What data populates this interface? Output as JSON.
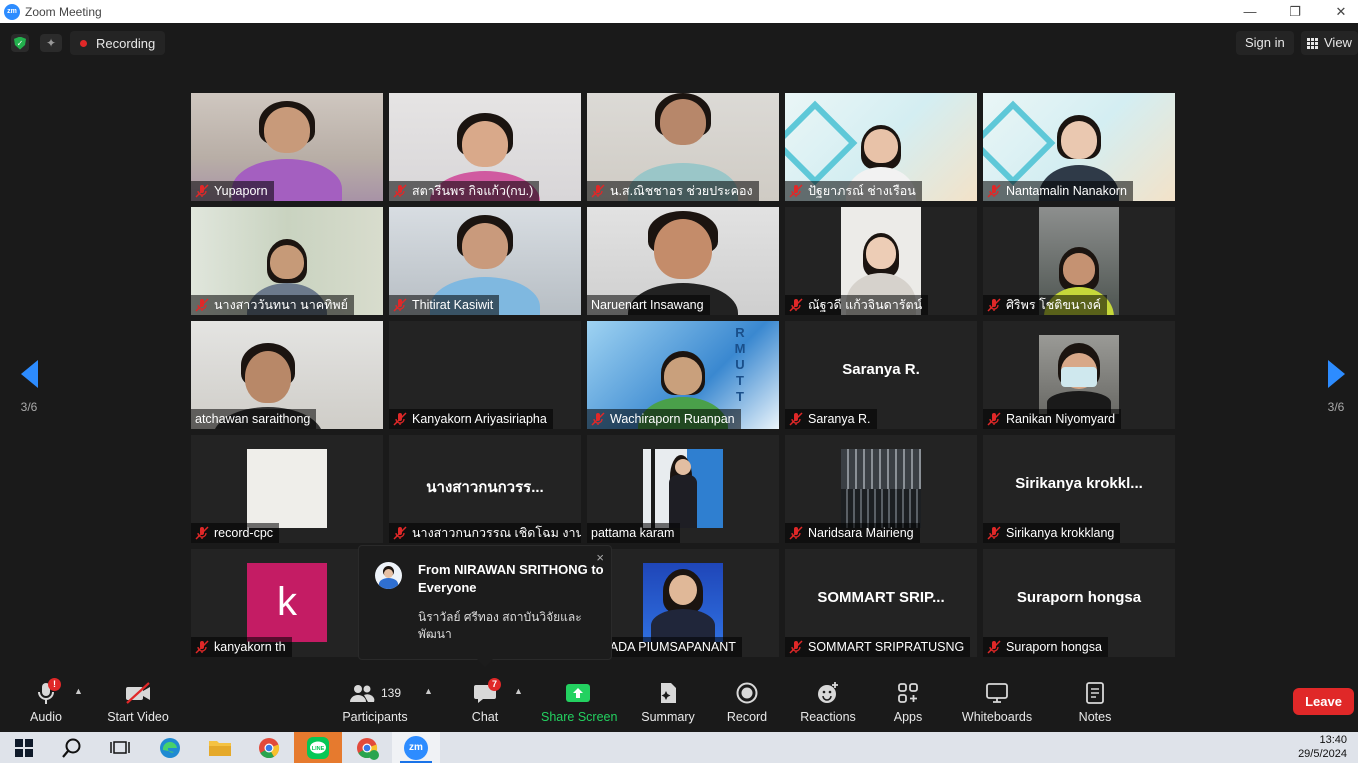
{
  "window": {
    "title": "Zoom Meeting",
    "logo": "zm"
  },
  "topbar": {
    "recording_label": "Recording",
    "signin_label": "Sign in",
    "view_label": "View"
  },
  "pager": {
    "left": "3/6",
    "right": "3/6"
  },
  "participants": [
    {
      "name": "Yupaporn",
      "muted": true
    },
    {
      "name": "สตารีนพร กิจแก้ว(กบ.)",
      "muted": true
    },
    {
      "name": "น.ส.ณิชชาอร ช่วยประคอง",
      "muted": true
    },
    {
      "name": "ปัฐยาภรณ์ ช่างเรือน",
      "muted": true
    },
    {
      "name": "Nantamalin Nanakorn",
      "muted": true
    },
    {
      "name": "นางสาววันทนา นาคทิพย์",
      "muted": true
    },
    {
      "name": "Thitirat Kasiwit",
      "muted": true
    },
    {
      "name": "Naruenart Insawang",
      "muted": false
    },
    {
      "name": "ณัฐวดี แก้วจินดารัตน์",
      "muted": true
    },
    {
      "name": "ศิริพร โชติขนางค์",
      "muted": true
    },
    {
      "name": "atchawan saraithong",
      "muted": false
    },
    {
      "name": "Kanyakorn Ariyasiriapha",
      "muted": true
    },
    {
      "name": "Wachiraporn Ruanpan",
      "muted": true
    },
    {
      "name": "Saranya R.",
      "muted": true,
      "display": "Saranya R."
    },
    {
      "name": "Ranikan Niyomyard",
      "muted": true
    },
    {
      "name": "record-cpc",
      "muted": true
    },
    {
      "name": "นางสาวกนกวรรณ เชิดโฉม งาน...",
      "muted": true,
      "display": "นางสาวกนกวรร..."
    },
    {
      "name": "pattama karam",
      "muted": false
    },
    {
      "name": "Naridsara Mairieng",
      "muted": true
    },
    {
      "name": "Sirikanya krokklang",
      "muted": true,
      "display": "Sirikanya  krokkl..."
    },
    {
      "name": "kanyakorn th",
      "muted": true,
      "avatar_letter": "k"
    },
    {
      "name": "",
      "muted": false
    },
    {
      "name": "ORADA PIUMSAPANANT",
      "muted": false
    },
    {
      "name": "SOMMART SRIPRATUSNG",
      "muted": true,
      "display": "SOMMART  SRIP..."
    },
    {
      "name": "Suraporn hongsa",
      "muted": true,
      "display": "Suraporn hongsa"
    }
  ],
  "chat_popup": {
    "from": "From NIRAWAN SRITHONG to Everyone",
    "message": "นิราวัลย์ ศรีทอง สถาบันวิจัยและพัฒนา",
    "close": "×"
  },
  "toolbar": {
    "audio": "Audio",
    "start_video": "Start Video",
    "participants": "Participants",
    "participants_count": "139",
    "chat": "Chat",
    "chat_badge": "7",
    "share_screen": "Share Screen",
    "summary": "Summary",
    "record": "Record",
    "reactions": "Reactions",
    "apps": "Apps",
    "whiteboards": "Whiteboards",
    "notes": "Notes",
    "leave": "Leave",
    "audio_badge": "!"
  },
  "taskbar": {
    "time": "13:40",
    "date": "29/5/2024",
    "zoom_label": "zm"
  },
  "colors": {
    "accent": "#2d8cff",
    "danger": "#e02828",
    "green": "#23d160",
    "bg": "#1a1a1a"
  }
}
